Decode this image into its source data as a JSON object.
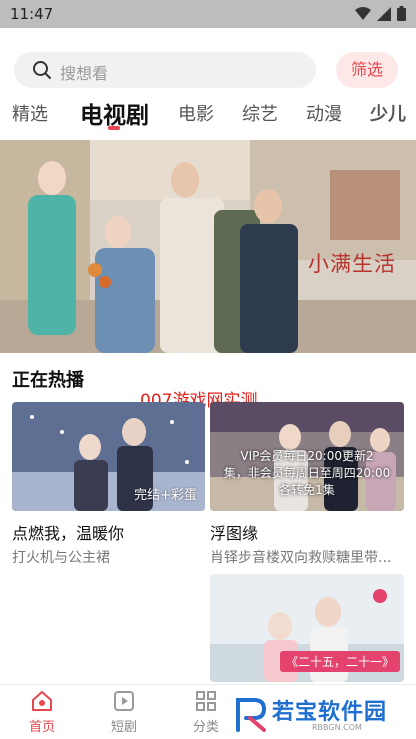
{
  "status": {
    "time": "11:47"
  },
  "search": {
    "placeholder": "搜想看",
    "filter_label": "筛选"
  },
  "tabs": [
    {
      "label": "精选"
    },
    {
      "label": "电视剧"
    },
    {
      "label": "电影"
    },
    {
      "label": "综艺"
    },
    {
      "label": "动漫"
    },
    {
      "label": "少儿"
    }
  ],
  "banner": {
    "title": "小满生活"
  },
  "section": {
    "title": "正在热播"
  },
  "watermark": "007游戏网实测",
  "cards": [
    {
      "badge": "完结+彩蛋",
      "title": "点燃我，温暖你",
      "subtitle": "打火机与公主裙"
    },
    {
      "overlay_line1": "VIP会员每日20:00更新2",
      "overlay_line2": "集，非会员每周日至周四20:00",
      "overlay_line3": "各转免1集",
      "title": "浮图缘",
      "subtitle": "肖铎步音楼双向救赎糖里带..."
    },
    {
      "tag": "《二十五，二十一》"
    }
  ],
  "bottom_nav": [
    {
      "label": "首页"
    },
    {
      "label": "短剧"
    },
    {
      "label": "分类"
    }
  ],
  "logo": {
    "text": "若宝软件园",
    "sub": "RBBGN.COM"
  },
  "colors": {
    "accent": "#e8474f",
    "filter_bg": "#fde7e7",
    "watermark": "#e2221b"
  }
}
